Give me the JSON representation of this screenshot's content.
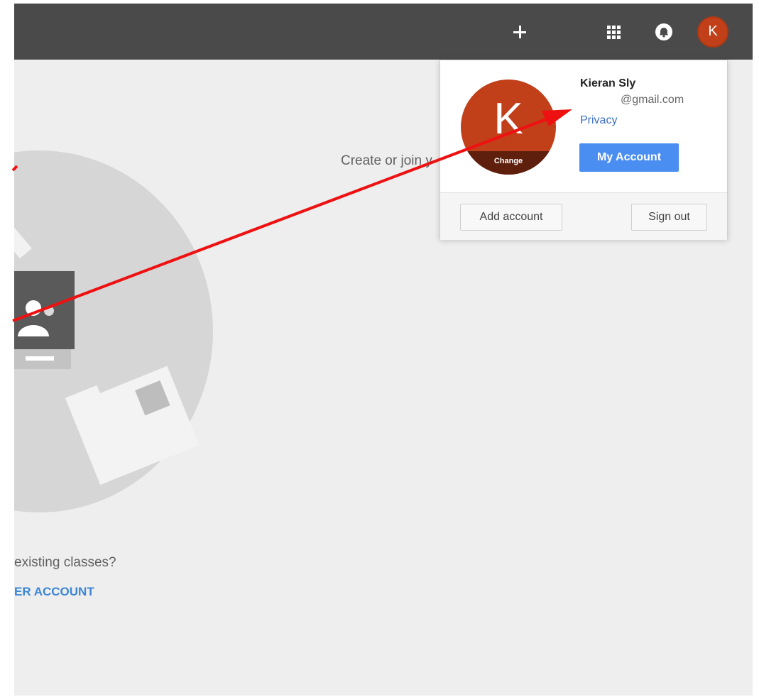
{
  "topbar": {
    "add_icon": "plus-icon",
    "apps_icon": "apps-grid-icon",
    "notifications_icon": "bell-icon",
    "avatar_letter": "K"
  },
  "main": {
    "create_join_text": "Create or join y",
    "existing_text": "existing classes?",
    "account_link": "ER ACCOUNT"
  },
  "account_card": {
    "avatar_letter": "K",
    "change_label": "Change",
    "name": "Kieran Sly",
    "email": "@gmail.com",
    "privacy_label": "Privacy",
    "my_account_label": "My Account",
    "add_account_label": "Add account",
    "sign_out_label": "Sign out"
  },
  "colors": {
    "topbar": "#4a4a4a",
    "avatar": "#c1401a",
    "primary_button": "#4b8ef1",
    "annotation_arrow": "#ee1111"
  }
}
